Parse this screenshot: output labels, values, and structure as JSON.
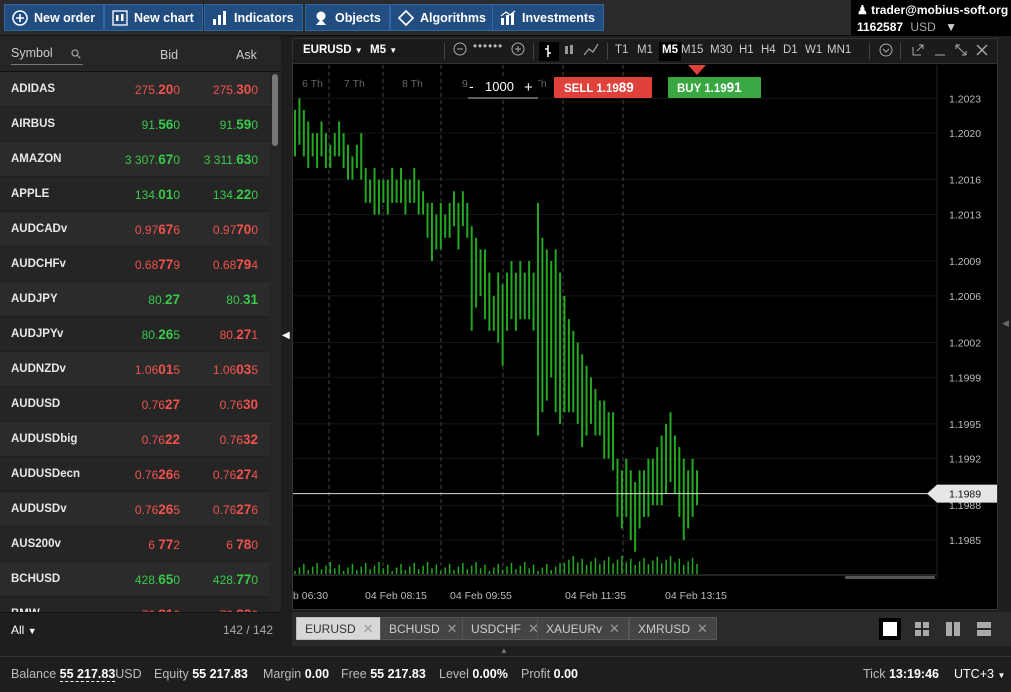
{
  "toolbar": {
    "new_order": "New order",
    "new_chart": "New chart",
    "indicators": "Indicators",
    "objects": "Objects",
    "algorithms": "Algorithms",
    "investments": "Investments"
  },
  "account": {
    "user": "trader@mobius-soft.org",
    "number": "1162587",
    "currency": "USD"
  },
  "watchlist": {
    "columns": {
      "symbol": "Symbol",
      "bid": "Bid",
      "ask": "Ask"
    },
    "rows": [
      {
        "symbol": "ADIDAS",
        "bid": [
          "275.",
          "20",
          "0"
        ],
        "ask": [
          "275.",
          "30",
          "0"
        ],
        "dir": "dn"
      },
      {
        "symbol": "AIRBUS",
        "bid": [
          "91.",
          "56",
          "0"
        ],
        "ask": [
          "91.",
          "59",
          "0"
        ],
        "dir": "up"
      },
      {
        "symbol": "AMAZON",
        "bid": [
          "3 307.",
          "67",
          "0"
        ],
        "ask": [
          "3 311.",
          "63",
          "0"
        ],
        "dir": "up"
      },
      {
        "symbol": "APPLE",
        "bid": [
          "134.",
          "01",
          "0"
        ],
        "ask": [
          "134.",
          "22",
          "0"
        ],
        "dir": "up"
      },
      {
        "symbol": "AUDCADv",
        "bid": [
          "0.97",
          "67",
          "6"
        ],
        "ask": [
          "0.97",
          "70",
          "0"
        ],
        "dir": "dn"
      },
      {
        "symbol": "AUDCHFv",
        "bid": [
          "0.68",
          "77",
          "9"
        ],
        "ask": [
          "0.68",
          "79",
          "4"
        ],
        "dir": "dn"
      },
      {
        "symbol": "AUDJPY",
        "bid": [
          "80.",
          "27",
          ""
        ],
        "ask": [
          "80.",
          "31",
          ""
        ],
        "dir": "up"
      },
      {
        "symbol": "AUDJPYv",
        "bid": [
          "80.",
          "26",
          "5"
        ],
        "ask": [
          "80.",
          "27",
          "1"
        ],
        "dir": "mix"
      },
      {
        "symbol": "AUDNZDv",
        "bid": [
          "1.06",
          "01",
          "5"
        ],
        "ask": [
          "1.06",
          "03",
          "5"
        ],
        "dir": "dn"
      },
      {
        "symbol": "AUDUSD",
        "bid": [
          "0.76",
          "27",
          ""
        ],
        "ask": [
          "0.76",
          "30",
          ""
        ],
        "dir": "dn"
      },
      {
        "symbol": "AUDUSDbig",
        "bid": [
          "0.76",
          "22",
          ""
        ],
        "ask": [
          "0.76",
          "32",
          ""
        ],
        "dir": "dn"
      },
      {
        "symbol": "AUDUSDecn",
        "bid": [
          "0.76",
          "26",
          "6"
        ],
        "ask": [
          "0.76",
          "27",
          "4"
        ],
        "dir": "dn"
      },
      {
        "symbol": "AUDUSDv",
        "bid": [
          "0.76",
          "26",
          "5"
        ],
        "ask": [
          "0.76",
          "27",
          "6"
        ],
        "dir": "dn"
      },
      {
        "symbol": "AUS200v",
        "bid": [
          "6 ",
          "77",
          "2"
        ],
        "ask": [
          "6 ",
          "78",
          "0"
        ],
        "dir": "dn"
      },
      {
        "symbol": "BCHUSD",
        "bid": [
          "428.",
          "65",
          "0"
        ],
        "ask": [
          "428.",
          "77",
          "0"
        ],
        "dir": "up"
      },
      {
        "symbol": "BMW",
        "bid": [
          "72.",
          "81",
          "0"
        ],
        "ask": [
          "72.",
          "83",
          "0"
        ],
        "dir": "dn"
      }
    ],
    "filter": "All",
    "count": "142 / 142"
  },
  "chart_toolbar": {
    "symbol": "EURUSD",
    "timeframe_menu": "M5",
    "timeframes": [
      "T1",
      "M1",
      "M5",
      "M15",
      "M30",
      "H1",
      "H4",
      "D1",
      "W1",
      "MN1"
    ],
    "active_timeframe": "M5"
  },
  "trade_panel": {
    "volume": "1000",
    "sell_label": "SELL",
    "sell_price": [
      "1.19",
      "89"
    ],
    "buy_label": "BUY",
    "buy_price": [
      "1.19",
      "91"
    ]
  },
  "chart_data": {
    "type": "bar",
    "symbol": "EURUSD",
    "timeframe": "M5",
    "y_ticks": [
      "1.2023",
      "1.2020",
      "1.2016",
      "1.2013",
      "1.2009",
      "1.2006",
      "1.2002",
      "1.1999",
      "1.1995",
      "1.1992",
      "1.1988",
      "1.1985"
    ],
    "ylim": [
      1.1982,
      1.2025
    ],
    "current_price": "1.1989",
    "x_ticks": [
      "b 06:30",
      "04 Feb 08:15",
      "04 Feb 09:55",
      "04 Feb 11:35",
      "04 Feb 13:15"
    ],
    "day_labels": [
      "6 Th",
      "7 Th",
      "8 Th",
      "9 Th",
      "10 Th"
    ],
    "bars": [
      {
        "h": 1.2022,
        "l": 1.2018
      },
      {
        "h": 1.2023,
        "l": 1.2019
      },
      {
        "h": 1.2022,
        "l": 1.2018
      },
      {
        "h": 1.2021,
        "l": 1.2017
      },
      {
        "h": 1.202,
        "l": 1.2018
      },
      {
        "h": 1.202,
        "l": 1.2017
      },
      {
        "h": 1.2021,
        "l": 1.2018
      },
      {
        "h": 1.202,
        "l": 1.2017
      },
      {
        "h": 1.2019,
        "l": 1.2017
      },
      {
        "h": 1.202,
        "l": 1.2018
      },
      {
        "h": 1.2021,
        "l": 1.2018
      },
      {
        "h": 1.202,
        "l": 1.2017
      },
      {
        "h": 1.2019,
        "l": 1.2016
      },
      {
        "h": 1.2018,
        "l": 1.2016
      },
      {
        "h": 1.2019,
        "l": 1.2017
      },
      {
        "h": 1.202,
        "l": 1.2016
      },
      {
        "h": 1.2017,
        "l": 1.2014
      },
      {
        "h": 1.2016,
        "l": 1.2014
      },
      {
        "h": 1.2017,
        "l": 1.2013
      },
      {
        "h": 1.2016,
        "l": 1.2013
      },
      {
        "h": 1.2016,
        "l": 1.2014
      },
      {
        "h": 1.2016,
        "l": 1.2013
      },
      {
        "h": 1.2017,
        "l": 1.2014
      },
      {
        "h": 1.2016,
        "l": 1.2014
      },
      {
        "h": 1.2017,
        "l": 1.2014
      },
      {
        "h": 1.2016,
        "l": 1.2013
      },
      {
        "h": 1.2016,
        "l": 1.2014
      },
      {
        "h": 1.2017,
        "l": 1.2014
      },
      {
        "h": 1.2016,
        "l": 1.2013
      },
      {
        "h": 1.2015,
        "l": 1.2013
      },
      {
        "h": 1.2014,
        "l": 1.2011
      },
      {
        "h": 1.2014,
        "l": 1.2009
      },
      {
        "h": 1.2013,
        "l": 1.201
      },
      {
        "h": 1.2014,
        "l": 1.201
      },
      {
        "h": 1.2013,
        "l": 1.2011
      },
      {
        "h": 1.2014,
        "l": 1.2011
      },
      {
        "h": 1.2015,
        "l": 1.2012
      },
      {
        "h": 1.2014,
        "l": 1.201
      },
      {
        "h": 1.2015,
        "l": 1.2012
      },
      {
        "h": 1.2014,
        "l": 1.2011
      },
      {
        "h": 1.2012,
        "l": 1.2003
      },
      {
        "h": 1.2011,
        "l": 1.2005
      },
      {
        "h": 1.201,
        "l": 1.2006
      },
      {
        "h": 1.201,
        "l": 1.2004
      },
      {
        "h": 1.2008,
        "l": 1.2003
      },
      {
        "h": 1.2006,
        "l": 1.2003
      },
      {
        "h": 1.2008,
        "l": 1.2002
      },
      {
        "h": 1.2007,
        "l": 1.2
      },
      {
        "h": 1.2008,
        "l": 1.2003
      },
      {
        "h": 1.2009,
        "l": 1.2004
      },
      {
        "h": 1.2008,
        "l": 1.2003
      },
      {
        "h": 1.2009,
        "l": 1.2004
      },
      {
        "h": 1.2008,
        "l": 1.2004
      },
      {
        "h": 1.2009,
        "l": 1.2004
      },
      {
        "h": 1.2008,
        "l": 1.2003
      },
      {
        "h": 1.2014,
        "l": 1.1994
      },
      {
        "h": 1.2011,
        "l": 1.1996
      },
      {
        "h": 1.201,
        "l": 1.1997
      },
      {
        "h": 1.2009,
        "l": 1.1999
      },
      {
        "h": 1.201,
        "l": 1.1996
      },
      {
        "h": 1.2008,
        "l": 1.1995
      },
      {
        "h": 1.2006,
        "l": 1.1996
      },
      {
        "h": 1.2004,
        "l": 1.1996
      },
      {
        "h": 1.2003,
        "l": 1.1996
      },
      {
        "h": 1.2002,
        "l": 1.1995
      },
      {
        "h": 1.2001,
        "l": 1.1993
      },
      {
        "h": 1.2,
        "l": 1.1994
      },
      {
        "h": 1.1999,
        "l": 1.1995
      },
      {
        "h": 1.1998,
        "l": 1.1994
      },
      {
        "h": 1.1997,
        "l": 1.1994
      },
      {
        "h": 1.1997,
        "l": 1.1992
      },
      {
        "h": 1.1996,
        "l": 1.1992
      },
      {
        "h": 1.1996,
        "l": 1.1991
      },
      {
        "h": 1.1992,
        "l": 1.1987
      },
      {
        "h": 1.1991,
        "l": 1.1986
      },
      {
        "h": 1.1992,
        "l": 1.1987
      },
      {
        "h": 1.1991,
        "l": 1.1985
      },
      {
        "h": 1.199,
        "l": 1.1984
      },
      {
        "h": 1.1991,
        "l": 1.1986
      },
      {
        "h": 1.1991,
        "l": 1.1987
      },
      {
        "h": 1.1992,
        "l": 1.1987
      },
      {
        "h": 1.1992,
        "l": 1.1988
      },
      {
        "h": 1.1993,
        "l": 1.1988
      },
      {
        "h": 1.1994,
        "l": 1.1988
      },
      {
        "h": 1.1995,
        "l": 1.1989
      },
      {
        "h": 1.1996,
        "l": 1.199
      },
      {
        "h": 1.1994,
        "l": 1.1989
      },
      {
        "h": 1.1993,
        "l": 1.1987
      },
      {
        "h": 1.1992,
        "l": 1.1985
      },
      {
        "h": 1.1991,
        "l": 1.1986
      },
      {
        "h": 1.1992,
        "l": 1.1987
      },
      {
        "h": 1.1991,
        "l": 1.1988
      }
    ]
  },
  "chart_tabs": [
    {
      "label": "EURUSD",
      "active": true
    },
    {
      "label": "BCHUSD",
      "active": false
    },
    {
      "label": "USDCHF",
      "active": false
    },
    {
      "label": "XAUEURv",
      "active": false
    },
    {
      "label": "XMRUSD",
      "active": false
    }
  ],
  "status": {
    "balance_label": "Balance",
    "balance": "55 217.83",
    "balance_cur": "USD",
    "equity_label": "Equity",
    "equity": "55 217.83",
    "margin_label": "Margin",
    "margin": "0.00",
    "free_label": "Free",
    "free": "55 217.83",
    "level_label": "Level",
    "level": "0.00%",
    "profit_label": "Profit",
    "profit": "0.00",
    "tick_label": "Tick",
    "tick": "13:19:46",
    "tz": "UTC+3"
  },
  "colors": {
    "up": "#39c94a",
    "down": "#f0524d",
    "accent": "#214d80",
    "bar": "#23a822",
    "sell": "#e0413b",
    "buy": "#3aa842"
  }
}
